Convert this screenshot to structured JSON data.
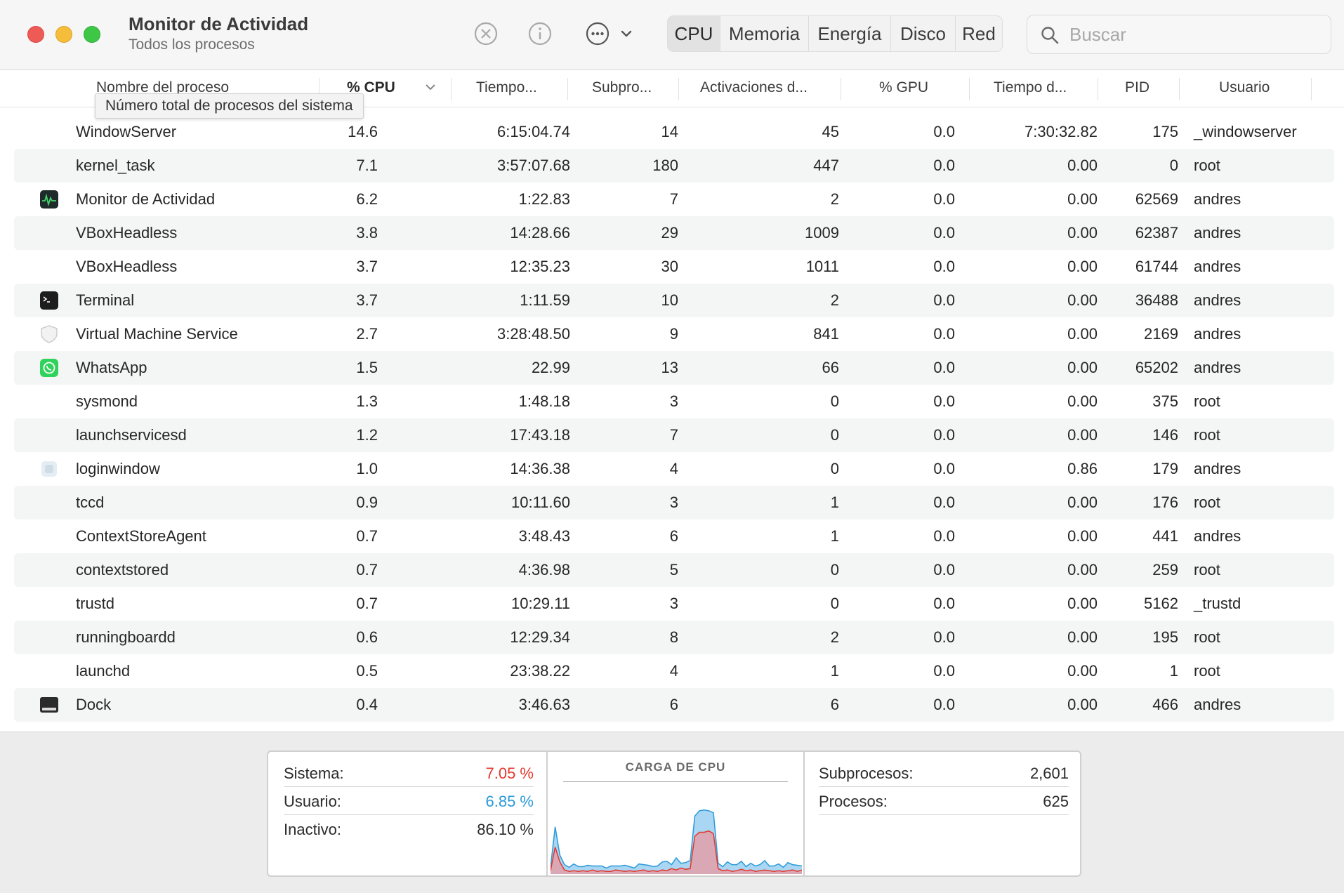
{
  "window": {
    "title": "Monitor de Actividad",
    "subtitle": "Todos los procesos"
  },
  "toolbar": {
    "icons": [
      "stop-process-icon",
      "info-icon",
      "more-options-icon",
      "chevron-down-icon"
    ],
    "tabs": [
      "CPU",
      "Memoria",
      "Energía",
      "Disco",
      "Red"
    ],
    "active_tab": "CPU",
    "search_placeholder": "Buscar"
  },
  "columns": [
    "Nombre del proceso",
    "% CPU",
    "Tiempo...",
    "Subpro...",
    "Activaciones d...",
    "% GPU",
    "Tiempo d...",
    "PID",
    "Usuario"
  ],
  "sorted_column": "% CPU",
  "tooltip": "Número total de procesos del sistema",
  "rows": [
    {
      "name": "WindowServer",
      "icon": "",
      "cpu": "14.6",
      "time": "6:15:04.74",
      "sub": "14",
      "act": "45",
      "gpu": "0.0",
      "gput": "7:30:32.82",
      "pid": "175",
      "user": "_windowserver"
    },
    {
      "name": "kernel_task",
      "icon": "",
      "cpu": "7.1",
      "time": "3:57:07.68",
      "sub": "180",
      "act": "447",
      "gpu": "0.0",
      "gput": "0.00",
      "pid": "0",
      "user": "root"
    },
    {
      "name": "Monitor de Actividad",
      "icon": "activity-monitor-icon",
      "cpu": "6.2",
      "time": "1:22.83",
      "sub": "7",
      "act": "2",
      "gpu": "0.0",
      "gput": "0.00",
      "pid": "62569",
      "user": "andres"
    },
    {
      "name": "VBoxHeadless",
      "icon": "",
      "cpu": "3.8",
      "time": "14:28.66",
      "sub": "29",
      "act": "1009",
      "gpu": "0.0",
      "gput": "0.00",
      "pid": "62387",
      "user": "andres"
    },
    {
      "name": "VBoxHeadless",
      "icon": "",
      "cpu": "3.7",
      "time": "12:35.23",
      "sub": "30",
      "act": "1011",
      "gpu": "0.0",
      "gput": "0.00",
      "pid": "61744",
      "user": "andres"
    },
    {
      "name": "Terminal",
      "icon": "terminal-icon",
      "cpu": "3.7",
      "time": "1:11.59",
      "sub": "10",
      "act": "2",
      "gpu": "0.0",
      "gput": "0.00",
      "pid": "36488",
      "user": "andres"
    },
    {
      "name": "Virtual Machine Service",
      "icon": "shield-icon",
      "cpu": "2.7",
      "time": "3:28:48.50",
      "sub": "9",
      "act": "841",
      "gpu": "0.0",
      "gput": "0.00",
      "pid": "2169",
      "user": "andres"
    },
    {
      "name": "WhatsApp",
      "icon": "whatsapp-icon",
      "cpu": "1.5",
      "time": "22.99",
      "sub": "13",
      "act": "66",
      "gpu": "0.0",
      "gput": "0.00",
      "pid": "65202",
      "user": "andres"
    },
    {
      "name": "sysmond",
      "icon": "",
      "cpu": "1.3",
      "time": "1:48.18",
      "sub": "3",
      "act": "0",
      "gpu": "0.0",
      "gput": "0.00",
      "pid": "375",
      "user": "root"
    },
    {
      "name": "launchservicesd",
      "icon": "",
      "cpu": "1.2",
      "time": "17:43.18",
      "sub": "7",
      "act": "0",
      "gpu": "0.0",
      "gput": "0.00",
      "pid": "146",
      "user": "root"
    },
    {
      "name": "loginwindow",
      "icon": "loginwindow-icon",
      "cpu": "1.0",
      "time": "14:36.38",
      "sub": "4",
      "act": "0",
      "gpu": "0.0",
      "gput": "0.86",
      "pid": "179",
      "user": "andres"
    },
    {
      "name": "tccd",
      "icon": "",
      "cpu": "0.9",
      "time": "10:11.60",
      "sub": "3",
      "act": "1",
      "gpu": "0.0",
      "gput": "0.00",
      "pid": "176",
      "user": "root"
    },
    {
      "name": "ContextStoreAgent",
      "icon": "",
      "cpu": "0.7",
      "time": "3:48.43",
      "sub": "6",
      "act": "1",
      "gpu": "0.0",
      "gput": "0.00",
      "pid": "441",
      "user": "andres"
    },
    {
      "name": "contextstored",
      "icon": "",
      "cpu": "0.7",
      "time": "4:36.98",
      "sub": "5",
      "act": "0",
      "gpu": "0.0",
      "gput": "0.00",
      "pid": "259",
      "user": "root"
    },
    {
      "name": "trustd",
      "icon": "",
      "cpu": "0.7",
      "time": "10:29.11",
      "sub": "3",
      "act": "0",
      "gpu": "0.0",
      "gput": "0.00",
      "pid": "5162",
      "user": "_trustd"
    },
    {
      "name": "runningboardd",
      "icon": "",
      "cpu": "0.6",
      "time": "12:29.34",
      "sub": "8",
      "act": "2",
      "gpu": "0.0",
      "gput": "0.00",
      "pid": "195",
      "user": "root"
    },
    {
      "name": "launchd",
      "icon": "",
      "cpu": "0.5",
      "time": "23:38.22",
      "sub": "4",
      "act": "1",
      "gpu": "0.0",
      "gput": "0.00",
      "pid": "1",
      "user": "root"
    },
    {
      "name": "Dock",
      "icon": "dock-icon",
      "cpu": "0.4",
      "time": "3:46.63",
      "sub": "6",
      "act": "6",
      "gpu": "0.0",
      "gput": "0.00",
      "pid": "466",
      "user": "andres"
    }
  ],
  "summary": {
    "sistema_label": "Sistema:",
    "sistema_value": "7.05 %",
    "usuario_label": "Usuario:",
    "usuario_value": "6.85 %",
    "inactivo_label": "Inactivo:",
    "inactivo_value": "86.10 %",
    "chart_title": "CARGA DE CPU",
    "subprocesos_label": "Subprocesos:",
    "subprocesos_value": "2,601",
    "procesos_label": "Procesos:",
    "procesos_value": "625"
  },
  "colors": {
    "system": "#e5372d",
    "user": "#2b9ad8"
  },
  "chart_data": {
    "type": "area",
    "title": "CARGA DE CPU",
    "xlabel": "",
    "ylabel": "",
    "ylim": [
      0,
      100
    ],
    "series": [
      {
        "name": "Sistema",
        "values": [
          5,
          40,
          18,
          6,
          4,
          5,
          4,
          5,
          4,
          6,
          4,
          5,
          4,
          4,
          6,
          5,
          4,
          5,
          4,
          5,
          6,
          4,
          5,
          4,
          6,
          5,
          8,
          6,
          9,
          7,
          8,
          56,
          62,
          62,
          64,
          60,
          8,
          5,
          6,
          4,
          5,
          7,
          5,
          6,
          4,
          5,
          6,
          5,
          4,
          5,
          4,
          5,
          6,
          4,
          6
        ]
      },
      {
        "name": "Usuario",
        "values": [
          5,
          30,
          10,
          8,
          6,
          10,
          7,
          6,
          9,
          6,
          8,
          7,
          5,
          8,
          6,
          7,
          9,
          6,
          5,
          10,
          8,
          9,
          6,
          8,
          12,
          14,
          6,
          18,
          7,
          10,
          12,
          30,
          32,
          33,
          30,
          31,
          8,
          6,
          12,
          10,
          9,
          12,
          6,
          10,
          8,
          9,
          14,
          7,
          8,
          10,
          6,
          12,
          8,
          9,
          6
        ]
      }
    ]
  }
}
